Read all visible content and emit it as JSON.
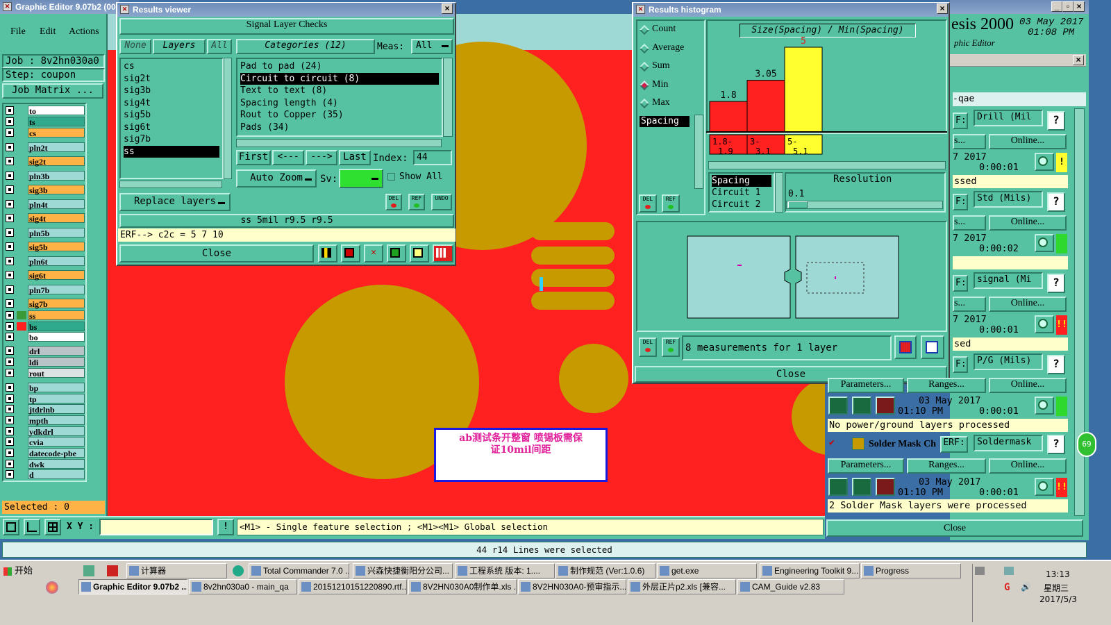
{
  "main_window": {
    "title": "Graphic Editor 9.07b2 (006",
    "menus": [
      "File",
      "Edit",
      "Actions",
      "C"
    ],
    "job_label": "Job : 8v2hn030a0",
    "step_label": "Step: coupon",
    "job_matrix": "Job Matrix ...",
    "selected": "Selected : 0",
    "xy_label": "X Y :",
    "hint": "<M1> - Single feature selection ; <M1><M1> Global selection",
    "status": "44 r14 Lines were selected"
  },
  "layers": [
    {
      "name": "to",
      "color": "#ffffff",
      "swatch": "#56c2a2"
    },
    {
      "name": "ts",
      "color": "#2faa8c",
      "swatch": "#56c2a2"
    },
    {
      "name": "cs",
      "color": "#ffb347",
      "swatch": "#56c2a2"
    },
    {
      "name": "pln2t",
      "color": "#9fd9d6",
      "swatch": "#56c2a2"
    },
    {
      "name": "sig2t",
      "color": "#ffb347",
      "swatch": "#56c2a2"
    },
    {
      "name": "pln3b",
      "color": "#9fd9d6",
      "swatch": "#56c2a2"
    },
    {
      "name": "sig3b",
      "color": "#ffb347",
      "swatch": "#56c2a2"
    },
    {
      "name": "pln4t",
      "color": "#9fd9d6",
      "swatch": "#56c2a2"
    },
    {
      "name": "sig4t",
      "color": "#ffb347",
      "swatch": "#56c2a2"
    },
    {
      "name": "pln5b",
      "color": "#9fd9d6",
      "swatch": "#56c2a2"
    },
    {
      "name": "sig5b",
      "color": "#ffb347",
      "swatch": "#56c2a2"
    },
    {
      "name": "pln6t",
      "color": "#9fd9d6",
      "swatch": "#56c2a2"
    },
    {
      "name": "sig6t",
      "color": "#ffb347",
      "swatch": "#56c2a2"
    },
    {
      "name": "pln7b",
      "color": "#9fd9d6",
      "swatch": "#56c2a2"
    },
    {
      "name": "sig7b",
      "color": "#ffb347",
      "swatch": "#56c2a2"
    },
    {
      "name": "ss",
      "color": "#ffb347",
      "swatch": "#3a9a3a"
    },
    {
      "name": "bs",
      "color": "#2faa8c",
      "swatch": "#ff2020"
    },
    {
      "name": "bo",
      "color": "#ffffff",
      "swatch": "#56c2a2"
    },
    {
      "name": "drl",
      "color": "#b9c4c8",
      "swatch": "#56c2a2"
    },
    {
      "name": "ldi",
      "color": "#b9c4c8",
      "swatch": "#56c2a2"
    },
    {
      "name": "rout",
      "color": "#dde3e3",
      "swatch": "#56c2a2"
    },
    {
      "name": "bp",
      "color": "#9fd9d6",
      "swatch": "#56c2a2"
    },
    {
      "name": "tp",
      "color": "#9fd9d6",
      "swatch": "#56c2a2"
    },
    {
      "name": "jtdrlnb",
      "color": "#9fd9d6",
      "swatch": "#56c2a2"
    },
    {
      "name": "mpth",
      "color": "#9fd9d6",
      "swatch": "#56c2a2"
    },
    {
      "name": "ydkdrl",
      "color": "#9fd9d6",
      "swatch": "#56c2a2"
    },
    {
      "name": "cvia",
      "color": "#9fd9d6",
      "swatch": "#56c2a2"
    },
    {
      "name": "datecode-pbe",
      "color": "#9fd9d6",
      "swatch": "#56c2a2"
    },
    {
      "name": "dwk",
      "color": "#9fd9d6",
      "swatch": "#56c2a2"
    },
    {
      "name": "d",
      "color": "#9fd9d6",
      "swatch": "#56c2a2"
    }
  ],
  "annotation": {
    "line1": "ab测试条开整窗 喷锡板需保",
    "line2": "证10mil间距"
  },
  "results_viewer": {
    "title": "Results viewer",
    "header": "Signal Layer Checks",
    "none": "None",
    "layers_btn": "Layers",
    "all": "All",
    "categories": "Categories (12)",
    "meas_label": "Meas:",
    "meas_value": "All",
    "layer_list": [
      "cs",
      "sig2t",
      "sig3b",
      "sig4t",
      "sig5b",
      "sig6t",
      "sig7b",
      "ss"
    ],
    "layer_selected": 7,
    "category_list": [
      "Pad to pad (24)",
      "Circuit to circuit (8)",
      "Text to text (8)",
      "Spacing length (4)",
      "Rout to Copper (35)",
      "Pads (34)"
    ],
    "category_selected": 1,
    "first": "First",
    "prev": "<---",
    "next": "--->",
    "last": "Last",
    "index_label": "Index:",
    "index_value": "44",
    "auto_zoom": "Auto Zoom",
    "sv_label": "Sv:",
    "show_all": "Show All",
    "replace_layers": "Replace layers",
    "del": "DEL",
    "ref": "REF",
    "undo": "UNDO",
    "info_line": "ss 5mil r9.5 r9.5",
    "erf_line": "ERF--> c2c = 5 7 10",
    "close": "Close"
  },
  "histogram": {
    "title": "Results histogram",
    "options": [
      "Count",
      "Average",
      "Sum",
      "Min",
      "Max"
    ],
    "option_selected": 3,
    "chart_title": "Size(Spacing) / Min(Spacing)",
    "category_item": "Spacing",
    "measure_list": [
      "Spacing",
      "Circuit 1",
      "Circuit 2"
    ],
    "resolution_label": "Resolution",
    "resolution_value": "0.1",
    "summary": "8 measurements for 1 layer",
    "close": "Close"
  },
  "chart_data": {
    "type": "bar",
    "title": "Size(Spacing) / Min(Spacing)",
    "categories": [
      "1.8-1.9",
      "3-3.1",
      "5-5.1"
    ],
    "values": [
      1.8,
      3.05,
      5
    ],
    "value_labels": [
      "1.8",
      "3.05",
      "5"
    ],
    "colors": [
      "#ff2020",
      "#ff2020",
      "#ffff30"
    ],
    "ylim": [
      0,
      5
    ]
  },
  "right_panel": {
    "title_big": "esis 2000",
    "date": "03 May 2017",
    "time": "01:08 PM",
    "subtitle": "phic Editor",
    "qae": "-qae",
    "rows": [
      {
        "erf": "F:",
        "field": "Drill (Mil",
        "online": "Online...",
        "ranges": "s...",
        "date": "7 2017",
        "dur": "0:00:01",
        "msg": "ssed",
        "flag": "#ffff30",
        "flagtext": "!"
      },
      {
        "erf": "F:",
        "field": "Std (Mils)",
        "online": "Online...",
        "ranges": "s...",
        "date": "7 2017",
        "dur": "0:00:02",
        "msg": "",
        "flag": "#2ed82e",
        "flagtext": ""
      },
      {
        "erf": "F:",
        "field": "signal (Mi",
        "online": "Online...",
        "ranges": "s...",
        "date": "7 2017",
        "dur": "0:00:01",
        "msg": "sed",
        "flag": "#ff2020",
        "flagtext": "!!"
      },
      {
        "erf": "F:",
        "field": "P/G (Mils)",
        "online": "Online...",
        "ranges": "Ranges...",
        "params": "Parameters...",
        "date": "03 May 2017",
        "time": "01:10 PM",
        "dur": "0:00:01",
        "msg": "No power/ground layers processed",
        "flag": "#2ed82e",
        "flagtext": ""
      }
    ],
    "soldermask": {
      "name": "Solder Mask Ch",
      "erf": "ERF:",
      "field": "Soldermask",
      "params": "Parameters...",
      "ranges": "Ranges...",
      "online": "Online...",
      "date": "03 May 2017",
      "time": "01:10 PM",
      "dur": "0:00:01",
      "msg": "2 Solder Mask layers were processed",
      "flag": "#ff2020",
      "flagtext": "!!"
    },
    "close": "Close",
    "badge": "69"
  },
  "taskbar": {
    "start": "开始",
    "row1": [
      "计算器",
      "Total Commander 7.0 ...",
      "兴森快捷衡阳分公司...",
      "工程系统 版本: 1....",
      "制作规范 (Ver:1.0.6)",
      "get.exe",
      "Engineering Toolkit 9....",
      "Progress"
    ],
    "row2": [
      "Graphic Editor 9.07b2 ...",
      "8v2hn030a0 - main_qa",
      "20151210151220890.rtf...",
      "8V2HN030A0制作单.xls ...",
      "8V2HN030A0-预审指示...",
      "外层正片p2.xls [兼容...",
      "CAM_Guide v2.83"
    ],
    "clock": "13:13",
    "weekday": "星期三",
    "date": "2017/5/3"
  }
}
